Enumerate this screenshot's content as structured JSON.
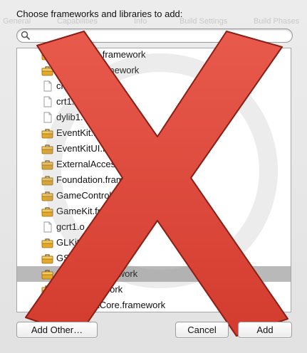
{
  "dialog": {
    "title": "Choose frameworks and libraries to add:",
    "search_placeholder": ""
  },
  "background_tabs": [
    "General",
    "Capabilities",
    "Info",
    "Build Settings",
    "Build Phases"
  ],
  "items": [
    {
      "label": "CoreVideo.framework",
      "icon": "framework-icon"
    },
    {
      "label": "CoreText.framework",
      "icon": "framework-icon"
    },
    {
      "label": "crt1.10.6.o",
      "icon": "file-icon"
    },
    {
      "label": "crt1.o",
      "icon": "file-icon"
    },
    {
      "label": "dylib1.o",
      "icon": "file-icon"
    },
    {
      "label": "EventKit.framework",
      "icon": "framework-icon"
    },
    {
      "label": "EventKitUI.framework",
      "icon": "framework-icon"
    },
    {
      "label": "ExternalAccessory.framework",
      "icon": "framework-icon"
    },
    {
      "label": "Foundation.framework",
      "icon": "framework-icon"
    },
    {
      "label": "GameController.framework",
      "icon": "framework-icon"
    },
    {
      "label": "GameKit.framework",
      "icon": "framework-icon"
    },
    {
      "label": "gcrt1.o",
      "icon": "file-icon"
    },
    {
      "label": "GLKit.framework",
      "icon": "framework-icon"
    },
    {
      "label": "GSS.framework",
      "icon": "framework-icon"
    },
    {
      "label": "ImageIO.framework",
      "icon": "framework-icon",
      "selected": true
    },
    {
      "label": "IOKit.framework",
      "icon": "framework-icon"
    },
    {
      "label": "JavaScriptCore.framework",
      "icon": "framework-icon"
    }
  ],
  "buttons": {
    "add_other": "Add Other…",
    "cancel": "Cancel",
    "add": "Add"
  },
  "colors": {
    "overlay_x": "#e0463a",
    "selection": "#b9b9b9"
  }
}
